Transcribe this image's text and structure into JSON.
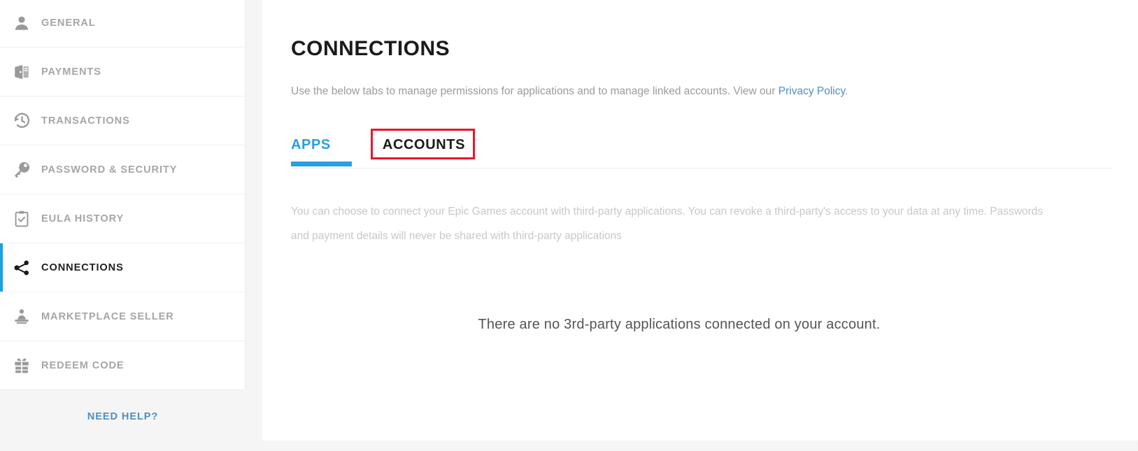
{
  "sidebar": {
    "items": [
      {
        "label": "GENERAL",
        "icon": "person-icon",
        "active": false
      },
      {
        "label": "PAYMENTS",
        "icon": "wallet-icon",
        "active": false
      },
      {
        "label": "TRANSACTIONS",
        "icon": "history-icon",
        "active": false
      },
      {
        "label": "PASSWORD & SECURITY",
        "icon": "key-icon",
        "active": false
      },
      {
        "label": "EULA HISTORY",
        "icon": "clipboard-check-icon",
        "active": false
      },
      {
        "label": "CONNECTIONS",
        "icon": "share-nodes-icon",
        "active": true
      },
      {
        "label": "MARKETPLACE SELLER",
        "icon": "seller-desk-icon",
        "active": false
      },
      {
        "label": "REDEEM CODE",
        "icon": "gift-icon",
        "active": false
      }
    ],
    "need_help": "NEED HELP?"
  },
  "main": {
    "title": "CONNECTIONS",
    "subtitle_prefix": "Use the below tabs to manage permissions for applications and to manage linked accounts. View our ",
    "subtitle_link": "Privacy Policy",
    "subtitle_suffix": ".",
    "tabs": [
      {
        "label": "APPS",
        "selected": true
      },
      {
        "label": "ACCOUNTS",
        "selected": false
      }
    ],
    "description": "You can choose to connect your Epic Games account with third-party applications. You can revoke a third-party's access to your data at any time. Passwords and payment details will never be shared with third-party applications",
    "empty_state": "There are no 3rd-party applications connected on your account."
  },
  "colors": {
    "accent_blue": "#28a0e2",
    "link_blue": "#4d8fc6",
    "highlight_red": "#e8172b",
    "muted_text": "#a6a6a6",
    "body_text": "#c8c8c8"
  }
}
